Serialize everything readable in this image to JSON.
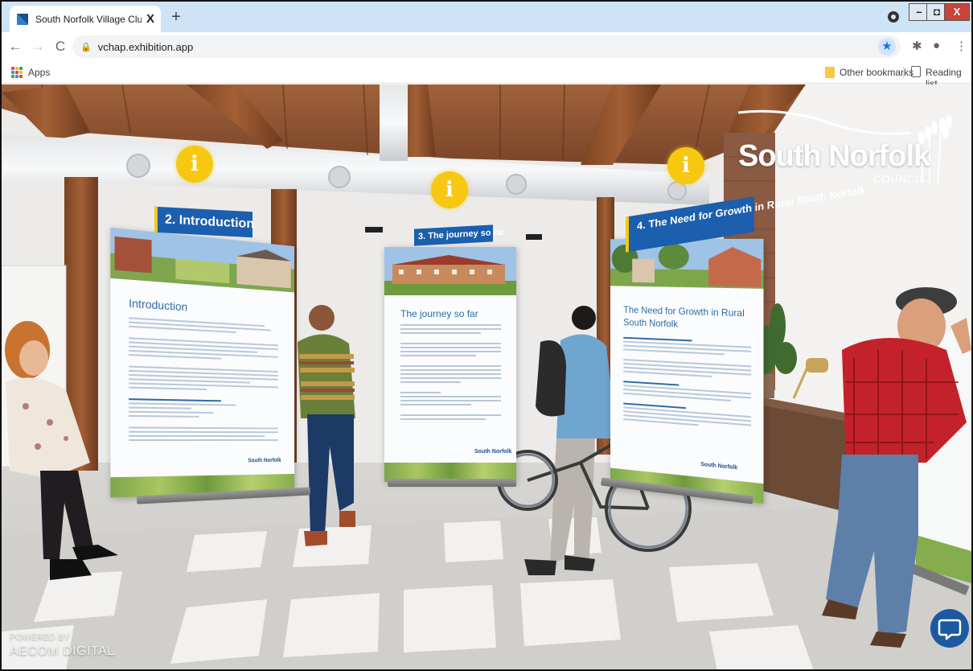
{
  "browser": {
    "tab_title": "South Norfolk Village Clusters Ho",
    "tab_close": "X",
    "new_tab": "+",
    "back": "←",
    "forward": "→",
    "reload": "C",
    "url": "vchap.exhibition.app",
    "window_controls": {
      "minimize": "–",
      "maximize": "◘",
      "close": "X"
    },
    "toolbar_icons": [
      "star-icon",
      "extensions-icon",
      "profile-icon",
      "menu-icon"
    ]
  },
  "bookmarks_bar": {
    "apps_label": "Apps",
    "other_bookmarks": "Other bookmarks",
    "reading_list": "Reading list"
  },
  "exhibition": {
    "brand": {
      "name": "South Norfolk",
      "sub": "COUNCIL"
    },
    "info_glyph": "i",
    "boards": [
      {
        "banner": "2. Introduction",
        "heading": "Introduction",
        "logo": "South Norfolk"
      },
      {
        "banner": "3. The journey so far",
        "heading": "The journey so far",
        "logo": "South Norfolk"
      },
      {
        "banner": "4. The Need for Growth in Rural South Norfolk",
        "heading": "The Need for Growth in Rural South Norfolk",
        "logo": "South Norfolk"
      }
    ],
    "powered_by": "POWERED BY",
    "powered_company": "AECOM DIGITAL"
  },
  "colors": {
    "chrome_tabstrip": "#cfe3f7",
    "accent_blue": "#1b5fae",
    "info_yellow": "#f6c812",
    "chat_button": "#1b5aa0"
  }
}
